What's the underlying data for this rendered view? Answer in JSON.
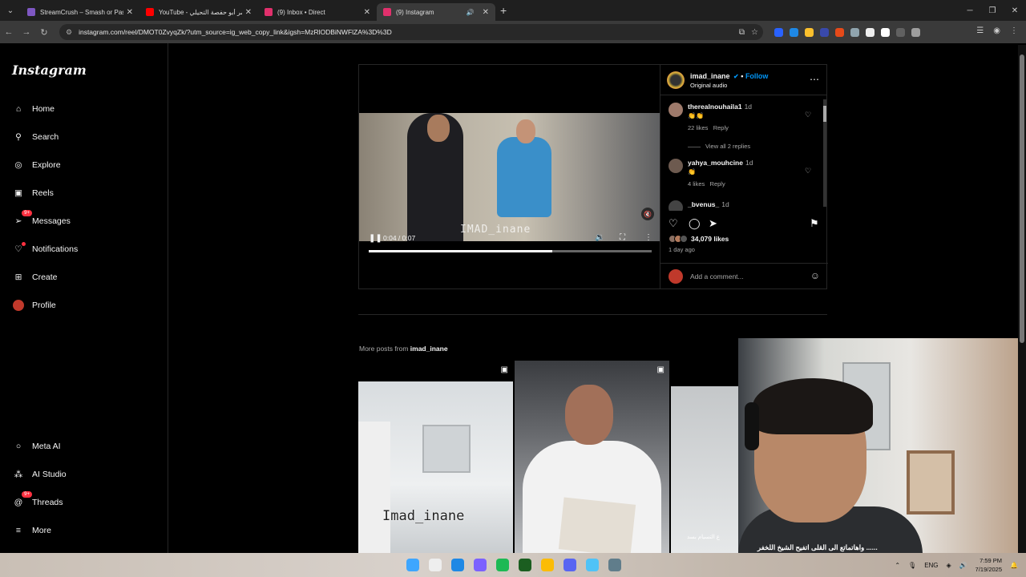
{
  "browser": {
    "tabs": [
      {
        "title": "StreamCrush – Smash or Pass Y",
        "color": "#7e57c2"
      },
      {
        "title": "YouTube - عمر أبو حفصة التحيلي",
        "color": "#ff0000"
      },
      {
        "title": "(9) Inbox • Direct",
        "color": "#e1306c"
      },
      {
        "title": "(9) Instagram",
        "color": "#e1306c"
      }
    ],
    "url": "instagram.com/reel/DMOT0ZvyqZk/?utm_source=ig_web_copy_link&igsh=MzRlODBiNWFlZA%3D%3D"
  },
  "sidebar": {
    "logo": "Instagram",
    "items": [
      {
        "label": "Home",
        "icon": "home-icon"
      },
      {
        "label": "Search",
        "icon": "search-icon"
      },
      {
        "label": "Explore",
        "icon": "explore-icon"
      },
      {
        "label": "Reels",
        "icon": "reels-icon"
      },
      {
        "label": "Messages",
        "icon": "messages-icon",
        "badge": "9+"
      },
      {
        "label": "Notifications",
        "icon": "heart-icon"
      },
      {
        "label": "Create",
        "icon": "create-icon"
      },
      {
        "label": "Profile",
        "icon": "avatar"
      }
    ],
    "bottom": [
      {
        "label": "Meta AI",
        "icon": "meta-ai-icon"
      },
      {
        "label": "AI Studio",
        "icon": "ai-studio-icon"
      },
      {
        "label": "Threads",
        "icon": "threads-icon",
        "badge": "9+"
      },
      {
        "label": "More",
        "icon": "menu-icon"
      }
    ]
  },
  "post": {
    "username": "imad_inane",
    "follow_label": "Follow",
    "separator": "•",
    "audio": "Original audio",
    "video": {
      "time": "0:04 / 0:07",
      "progress": 0.65,
      "watermark": "IMAD_inane"
    },
    "comments": [
      {
        "user": "therealnouhaila1",
        "ago": "1d",
        "text": "👏👏",
        "likes": "22 likes",
        "reply": "Reply"
      },
      {
        "user": "yahya_mouhcine",
        "ago": "1d",
        "text": "👏",
        "likes": "4 likes",
        "reply": "Reply"
      },
      {
        "user": "_bvenus_",
        "ago": "1d"
      }
    ],
    "view_replies": "View all 2 replies",
    "likes": "34,079 likes",
    "posted": "1 day ago",
    "comment_placeholder": "Add a comment..."
  },
  "more_posts": {
    "prefix": "More posts from",
    "user": "imad_inane",
    "thumb1_watermark": "Imad_inane",
    "thumb3_caption": "ع التسيام بسد"
  },
  "overlay": {
    "subtitle": "واهاتماتع الى القلى اتفيح الشيخ اللخفر ......"
  },
  "taskbar": {
    "lang": "ENG",
    "time": "7:59 PM",
    "date": "7/19/2025"
  }
}
